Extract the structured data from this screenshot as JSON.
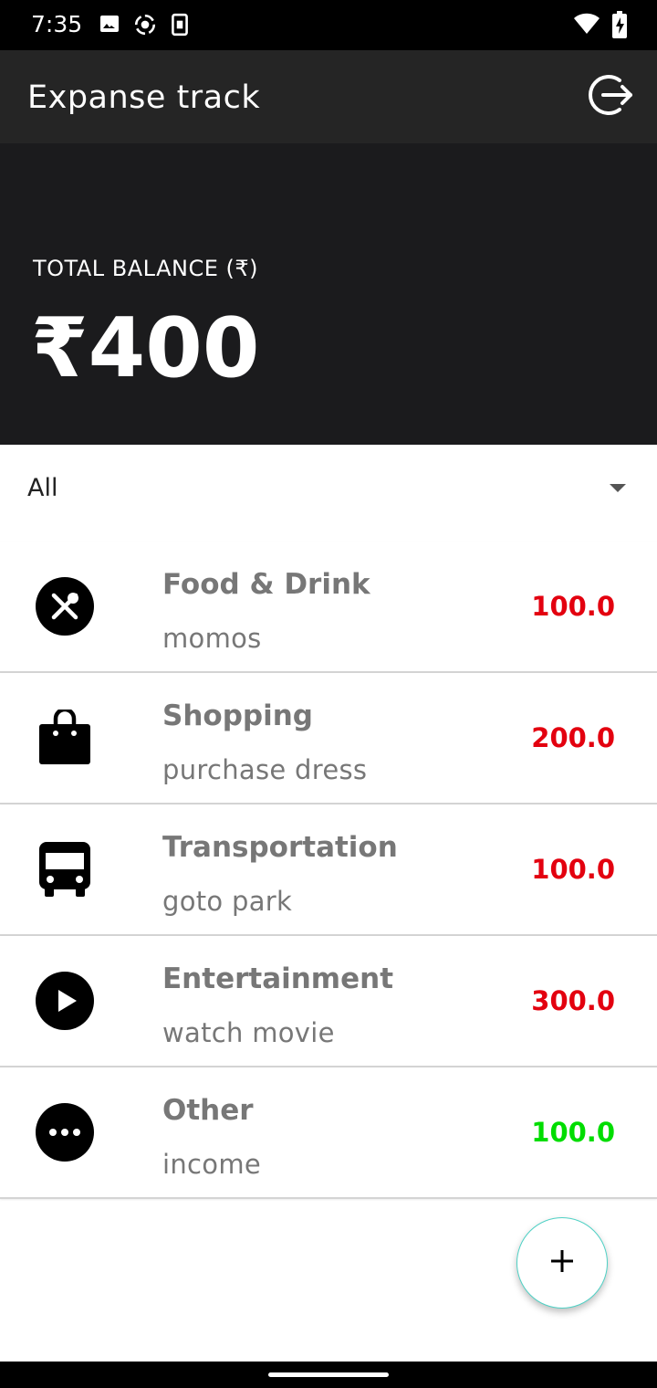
{
  "status_bar": {
    "time": "7:35",
    "left_icons": [
      "image-icon",
      "sync-icon",
      "sim-icon"
    ],
    "right_icons": [
      "wifi-icon",
      "battery-icon"
    ]
  },
  "app_bar": {
    "title": "Expanse track",
    "action_icon": "logout-icon"
  },
  "balance": {
    "label": "TOTAL BALANCE (₹)",
    "value": "₹400"
  },
  "filter": {
    "selected": "All"
  },
  "transactions": [
    {
      "category": "Food & Drink",
      "note": "momos",
      "amount": "100.0",
      "icon": "food-icon",
      "type": "expense"
    },
    {
      "category": "Shopping",
      "note": "purchase dress",
      "amount": "200.0",
      "icon": "shopping-bag-icon",
      "type": "expense"
    },
    {
      "category": "Transportation",
      "note": "goto park",
      "amount": "100.0",
      "icon": "bus-icon",
      "type": "expense"
    },
    {
      "category": "Entertainment",
      "note": "watch movie",
      "amount": "300.0",
      "icon": "play-icon",
      "type": "expense"
    },
    {
      "category": "Other",
      "note": "income",
      "amount": "100.0",
      "icon": "more-icon",
      "type": "income"
    }
  ],
  "fab": {
    "icon": "plus-icon"
  },
  "colors": {
    "expense": "#e3000f",
    "income": "#00dd00",
    "app_bar": "#252525",
    "balance_bg": "#1b1b1d",
    "fab_border": "#4fd1c5"
  }
}
